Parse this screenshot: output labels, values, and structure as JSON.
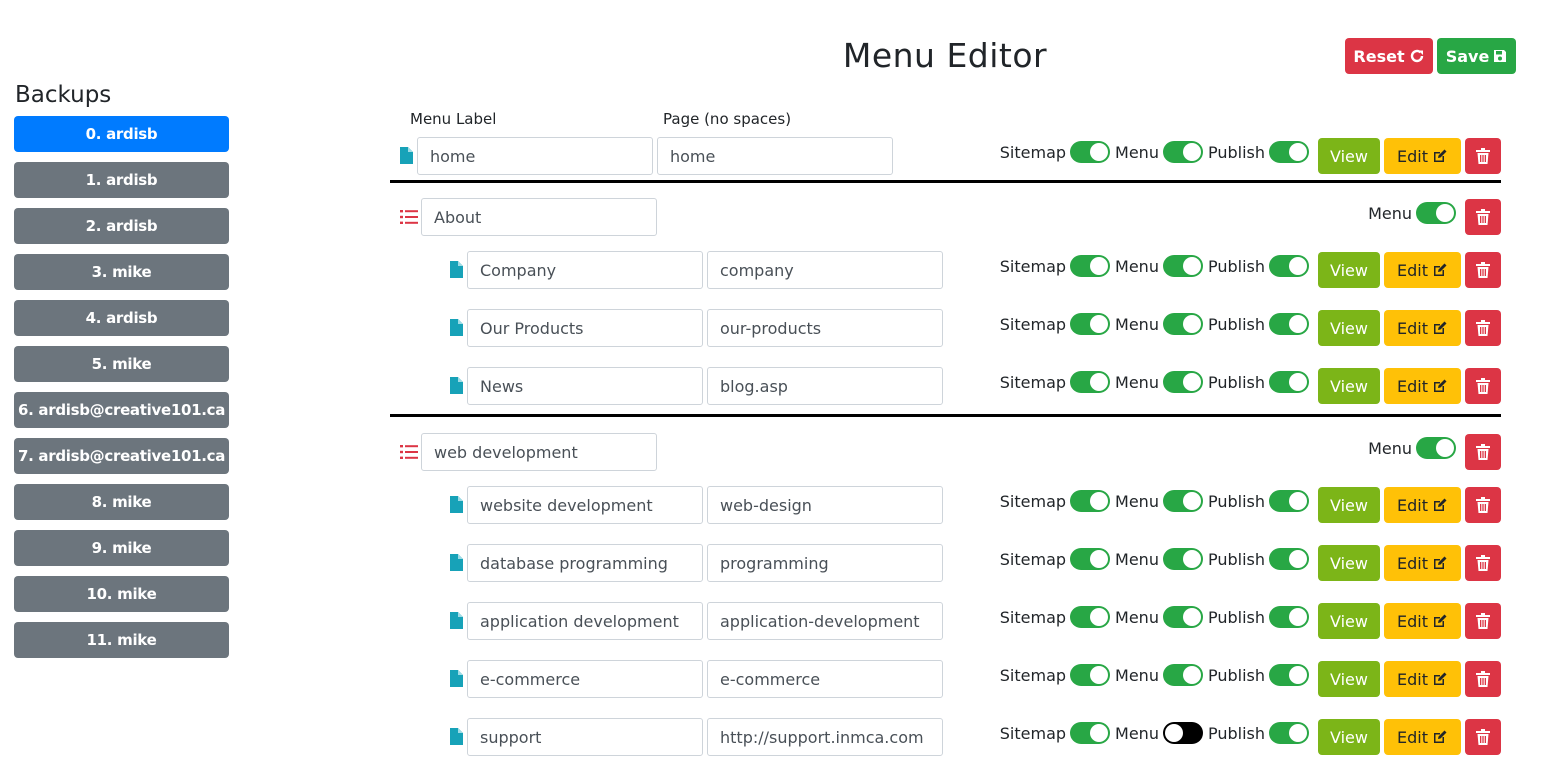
{
  "header": {
    "title": "Menu Editor",
    "reset_label": "Reset",
    "save_label": "Save"
  },
  "sidebar": {
    "title": "Backups",
    "items": [
      {
        "label": "0. ardisb",
        "active": true
      },
      {
        "label": "1. ardisb"
      },
      {
        "label": "2. ardisb"
      },
      {
        "label": "3. mike"
      },
      {
        "label": "4. ardisb"
      },
      {
        "label": "5. mike"
      },
      {
        "label": "6. ardisb@creative101.ca"
      },
      {
        "label": "7. ardisb@creative101.ca"
      },
      {
        "label": "8. mike"
      },
      {
        "label": "9. mike"
      },
      {
        "label": "10. mike"
      },
      {
        "label": "11. mike"
      }
    ]
  },
  "columns": {
    "menu_label": "Menu Label",
    "page": "Page (no spaces)"
  },
  "controls": {
    "sitemap": "Sitemap",
    "menu": "Menu",
    "publish": "Publish",
    "view": "View",
    "edit": "Edit"
  },
  "rows": [
    {
      "kind": "page",
      "label": "home",
      "page": "home",
      "menu_on": true
    },
    {
      "kind": "group",
      "label": "About"
    },
    {
      "kind": "page",
      "label": "Company",
      "page": "company",
      "menu_on": true
    },
    {
      "kind": "page",
      "label": "Our Products",
      "page": "our-products",
      "menu_on": true
    },
    {
      "kind": "page",
      "label": "News",
      "page": "blog.asp",
      "menu_on": true
    },
    {
      "kind": "group",
      "label": "web development"
    },
    {
      "kind": "page",
      "label": "website development",
      "page": "web-design",
      "menu_on": true
    },
    {
      "kind": "page",
      "label": "database programming",
      "page": "programming",
      "menu_on": true
    },
    {
      "kind": "page",
      "label": "application development",
      "page": "application-development",
      "menu_on": true
    },
    {
      "kind": "page",
      "label": "e-commerce",
      "page": "e-commerce",
      "menu_on": true
    },
    {
      "kind": "page",
      "label": "support",
      "page": "http://support.inmca.com",
      "menu_on": false
    }
  ],
  "colors": {
    "primary": "#007bff",
    "secondary": "#6c757d",
    "danger": "#dc3545",
    "success": "#28a745",
    "view": "#7cb518",
    "warning": "#ffc107",
    "page_icon": "#17a2b8"
  }
}
